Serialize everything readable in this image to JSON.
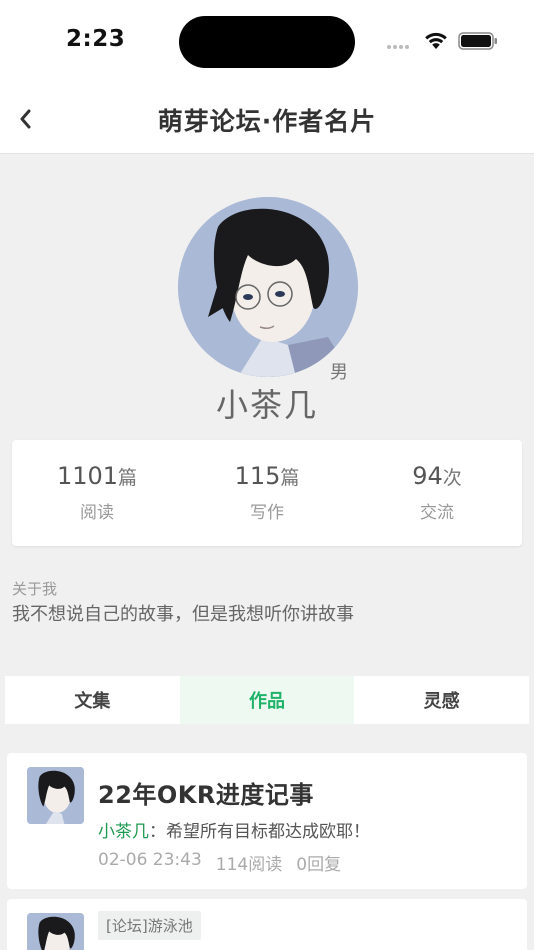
{
  "status_bar": {
    "time": "2:23"
  },
  "nav": {
    "title": "萌芽论坛·作者名片"
  },
  "profile": {
    "gender": "男",
    "name": "小茶几"
  },
  "stats": [
    {
      "value": "1101",
      "unit": "篇",
      "label": "阅读"
    },
    {
      "value": "115",
      "unit": "篇",
      "label": "写作"
    },
    {
      "value": "94",
      "unit": "次",
      "label": "交流"
    }
  ],
  "about": {
    "label": "关于我",
    "text": "我不想说自己的故事，但是我想听你讲故事"
  },
  "tabs": [
    {
      "label": "文集",
      "active": false
    },
    {
      "label": "作品",
      "active": true
    },
    {
      "label": "灵感",
      "active": false
    }
  ],
  "posts": [
    {
      "title": "22年OKR进度记事",
      "author": "小茶几",
      "separator": "：",
      "excerpt": "希望所有目标都达成欧耶！",
      "date": "02-06 23:43",
      "reads": "114阅读",
      "replies": "0回复"
    },
    {
      "forum_tag": "[论坛]游泳池"
    }
  ],
  "colors": {
    "accent_green": "#1fb36a",
    "tab_active_bg": "#eef9f2"
  }
}
